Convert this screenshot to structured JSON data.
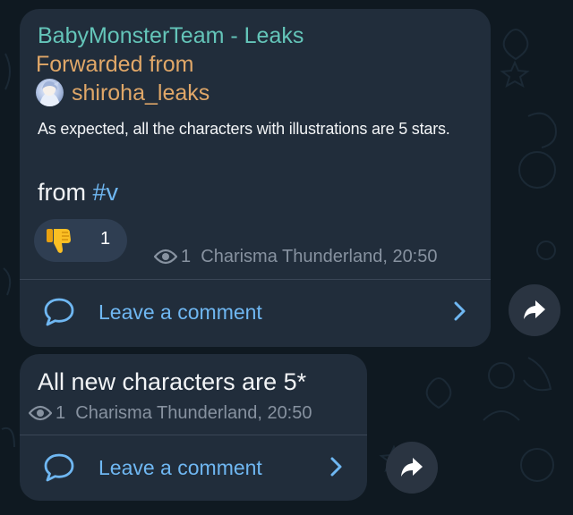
{
  "colors": {
    "background": "#0f1921",
    "bubble": "#212d3b",
    "channel_name": "#64c5b9",
    "forwarded": "#e0a768",
    "link": "#6fb7f2",
    "meta": "#8792a0"
  },
  "messages": [
    {
      "channel_name": "BabyMonsterTeam - Leaks",
      "forwarded_label": "Forwarded from",
      "source_name": "shiroha_leaks",
      "text": "As expected, all the characters with illustrations are 5 stars.",
      "from_prefix": "from ",
      "hashtag": "#v",
      "reaction": {
        "emoji": "thumbs-down",
        "count": "1"
      },
      "views": "1",
      "author_time": "Charisma Thunderland, 20:50",
      "comment_label": "Leave a comment",
      "icons": [
        "eye-icon",
        "comment-bubble-icon",
        "chevron-right-icon",
        "share-arrow-icon"
      ]
    },
    {
      "text": "All new characters are 5*",
      "views": "1",
      "author_time": "Charisma Thunderland, 20:50",
      "comment_label": "Leave a comment",
      "icons": [
        "eye-icon",
        "comment-bubble-icon",
        "chevron-right-icon",
        "share-arrow-icon"
      ]
    }
  ]
}
